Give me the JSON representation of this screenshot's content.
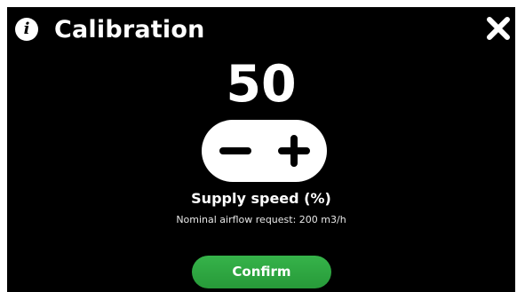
{
  "header": {
    "info_icon_glyph": "i",
    "title": "Calibration",
    "close_icon": "close-icon"
  },
  "stepper": {
    "value": "50",
    "minus_icon": "minus-icon",
    "plus_icon": "plus-icon",
    "label": "Supply speed (%)",
    "sublabel": "Nominal airflow request: 200 m3/h"
  },
  "footer": {
    "confirm_label": "Confirm"
  },
  "colors": {
    "background": "#000000",
    "text": "#ffffff",
    "confirm_button": "#2fa742"
  }
}
